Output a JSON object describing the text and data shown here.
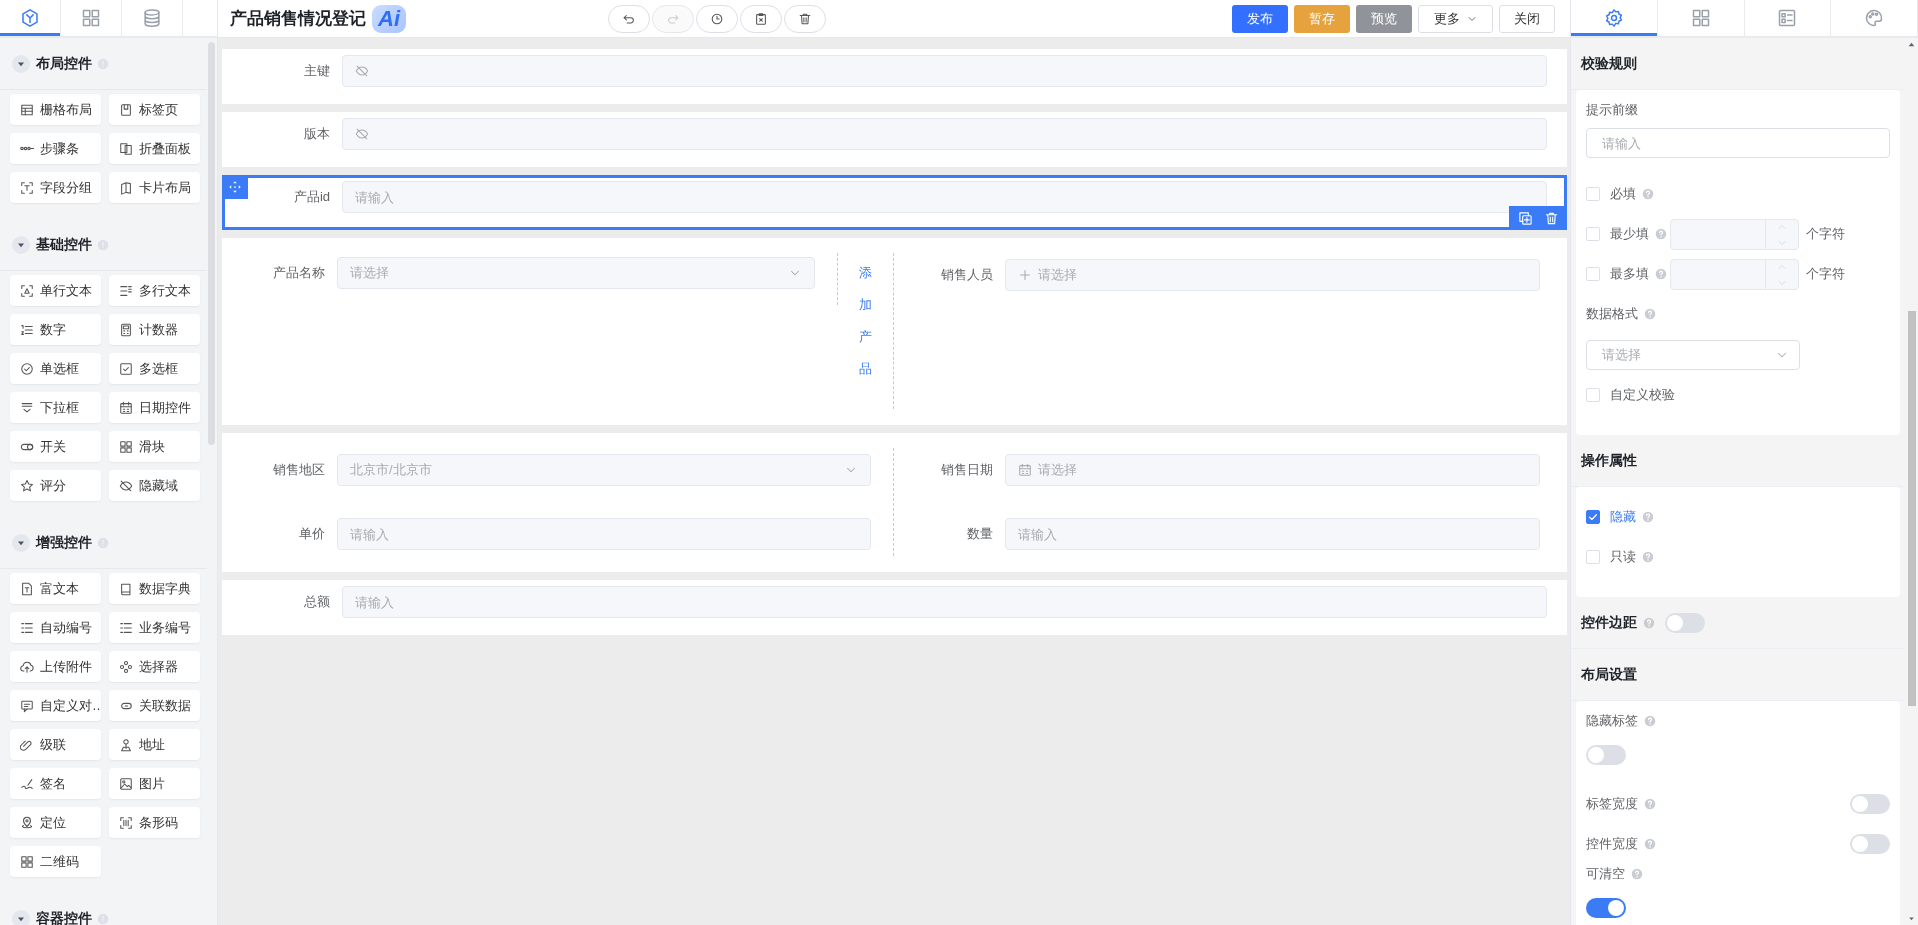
{
  "sidebar": {
    "tabs": [
      {
        "selected": true
      },
      {
        "selected": false
      },
      {
        "selected": false
      }
    ],
    "sections": [
      {
        "title": "布局控件",
        "expanded": true,
        "items": [
          "栅格布局",
          "标签页",
          "步骤条",
          "折叠面板",
          "字段分组",
          "卡片布局"
        ]
      },
      {
        "title": "基础控件",
        "expanded": true,
        "items": [
          "单行文本",
          "多行文本",
          "数字",
          "计数器",
          "单选框",
          "多选框",
          "下拉框",
          "日期控件",
          "开关",
          "滑块",
          "评分",
          "隐藏域"
        ]
      },
      {
        "title": "增强控件",
        "expanded": true,
        "items": [
          "富文本",
          "数据字典",
          "自动编号",
          "业务编号",
          "上传附件",
          "选择器",
          "自定义对…",
          "关联数据",
          "级联",
          "地址",
          "签名",
          "图片",
          "定位",
          "条形码",
          "二维码"
        ]
      },
      {
        "title": "容器控件",
        "expanded": true
      }
    ]
  },
  "toolbar": {
    "title": "产品销售情况登记",
    "badge": "Ai",
    "history": [
      {
        "disabled": false
      },
      {
        "disabled": true
      },
      {
        "disabled": false
      },
      {
        "disabled": false
      },
      {
        "disabled": false
      }
    ],
    "actions": [
      {
        "label": "发布",
        "kind": "primary"
      },
      {
        "label": "暂存",
        "kind": "warning"
      },
      {
        "label": "预览",
        "kind": "info"
      },
      {
        "label": "更多",
        "kind": "dropdown"
      },
      {
        "label": "关闭",
        "kind": "default"
      }
    ]
  },
  "form": {
    "rows": [
      {
        "kind": "single",
        "selected": false,
        "field": {
          "label": "主键",
          "kind": "masked"
        }
      },
      {
        "kind": "single",
        "selected": false,
        "field": {
          "label": "版本",
          "kind": "masked"
        }
      },
      {
        "kind": "single",
        "selected": true,
        "field": {
          "label": "产品id",
          "kind": "input",
          "placeholder": "请输入"
        }
      },
      {
        "kind": "grid",
        "selected": false,
        "link": "添加产品",
        "columns": [
          [
            {
              "label": "产品名称",
              "kind": "select",
              "placeholder": "请选择"
            }
          ],
          [
            {
              "label": "销售人员",
              "kind": "member",
              "placeholder": "请选择"
            }
          ]
        ]
      },
      {
        "kind": "grid",
        "selected": false,
        "columns": [
          [
            {
              "label": "销售地区",
              "kind": "select",
              "value": "北京市/北京市"
            },
            {
              "label": "单价",
              "kind": "input",
              "placeholder": "请输入"
            }
          ],
          [
            {
              "label": "销售日期",
              "kind": "date",
              "placeholder": "请选择"
            },
            {
              "label": "数量",
              "kind": "input",
              "placeholder": "请输入"
            }
          ]
        ]
      },
      {
        "kind": "single",
        "selected": false,
        "field": {
          "label": "总额",
          "kind": "input",
          "placeholder": "请输入"
        }
      }
    ]
  },
  "properties": {
    "tabs": [
      {
        "selected": true
      },
      {
        "selected": false
      },
      {
        "selected": false
      },
      {
        "selected": false
      }
    ],
    "sections": [
      {
        "title": "校验规则",
        "items": [
          {
            "kind": "text",
            "label": "提示前缀",
            "placeholder": "请输入"
          },
          {
            "kind": "check",
            "label": "必填",
            "help": true,
            "checked": false
          },
          {
            "kind": "count",
            "label": "最少填",
            "help": true,
            "checked": false,
            "unit": "个字符"
          },
          {
            "kind": "count",
            "label": "最多填",
            "help": true,
            "checked": false,
            "unit": "个字符"
          },
          {
            "kind": "select",
            "label": "数据格式",
            "help": true,
            "placeholder": "请选择"
          },
          {
            "kind": "check",
            "label": "自定义校验",
            "help": false,
            "checked": false
          }
        ]
      },
      {
        "title": "操作属性",
        "items": [
          {
            "kind": "check",
            "label": "隐藏",
            "help": true,
            "checked": true
          },
          {
            "kind": "check",
            "label": "只读",
            "help": true,
            "checked": false
          }
        ]
      },
      {
        "title": "控件边距",
        "help": true,
        "toggle": {
          "on": false
        }
      },
      {
        "title": "布局设置",
        "items": [
          {
            "kind": "toggle_below",
            "label": "隐藏标签",
            "help": true,
            "on": false
          },
          {
            "kind": "toggle_inline",
            "label": "标签宽度",
            "help": true,
            "on": false
          },
          {
            "kind": "toggle_inline",
            "label": "控件宽度",
            "help": true,
            "on": false
          },
          {
            "kind": "toggle_below",
            "label": "可清空",
            "help": true,
            "on": true
          }
        ]
      }
    ]
  }
}
